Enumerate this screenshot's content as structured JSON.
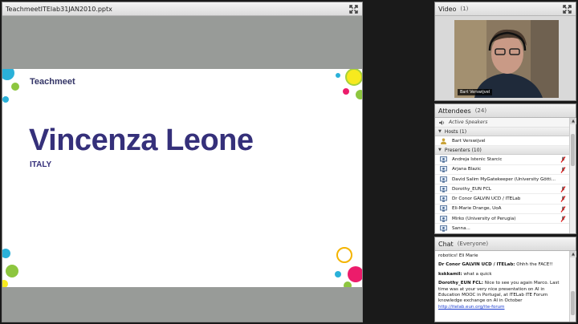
{
  "share": {
    "title": "TeachmeetITElab31JAN2010.pptx",
    "slide": {
      "pretitle": "Teachmeet",
      "name": "Vincenza Leone",
      "country": "ITALY"
    }
  },
  "video": {
    "title": "Video",
    "count": "(1)",
    "caption": "Bart Verswijvel"
  },
  "attendees": {
    "title": "Attendees",
    "count": "(24)",
    "active_speakers": "Active Speakers",
    "hosts_label": "Hosts (1)",
    "hosts": [
      {
        "name": "Bart Verswijvel"
      }
    ],
    "presenters_label": "Presenters (10)",
    "presenters": [
      {
        "name": "Andreja Istenic Starcic"
      },
      {
        "name": "Arjana Blazic"
      },
      {
        "name": "David Salim MyGatekeeper (University Götti..."
      },
      {
        "name": "Dorothy_EUN FCL"
      },
      {
        "name": "Dr Conor GALVIN UCD / ITELab"
      },
      {
        "name": "Eli-Marie Drange, UoA"
      },
      {
        "name": "Mirko (University of Perugia)"
      },
      {
        "name": "Sanna..."
      }
    ]
  },
  "chat": {
    "title": "Chat",
    "scope": "(Everyone)",
    "messages": [
      {
        "who": "",
        "text": "robotics! Eli Marie"
      },
      {
        "who": "Dr Conor GALVIN UCD / ITELab:",
        "text": "Ohhh the FACE!!"
      },
      {
        "who": "kskkamil:",
        "text": "what a quick"
      },
      {
        "who": "Dorothy_EUN FCL:",
        "text": "Nice to see you again Marco. Last time was at your very nice presentation on AI in Education MOOC in Portugal, at ITELab ITE Forum knowledge exchange on AI in October",
        "link": "http://itelab.eun.org/ite-forum"
      }
    ]
  },
  "colors": {
    "slide_title": "#35307a",
    "share_background": "#989b98",
    "chat_link": "#1a3ccf"
  }
}
